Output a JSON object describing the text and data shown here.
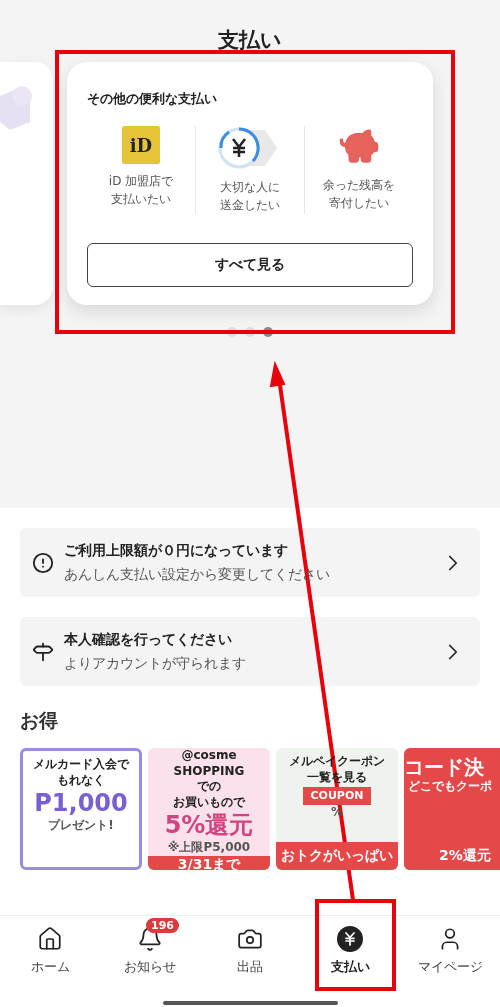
{
  "header": {
    "title": "支払い"
  },
  "carousel": {
    "card": {
      "title": "その他の便利な支払い",
      "options": [
        {
          "kind": "id",
          "icon_text": "iD",
          "lines": [
            "iD 加盟店で",
            "支払いたい"
          ]
        },
        {
          "kind": "transfer",
          "lines": [
            "大切な人に",
            "送金したい"
          ]
        },
        {
          "kind": "donate",
          "lines": [
            "余った残高を",
            "寄付したい"
          ]
        }
      ],
      "button": "すべて見る"
    },
    "pages": [
      {
        "selected": false
      },
      {
        "selected": false
      },
      {
        "selected": true
      }
    ]
  },
  "notices": [
    {
      "kind": "warning",
      "title": "ご利用上限額が０円になっています",
      "subtitle": "あんしん支払い設定から変更してください"
    },
    {
      "kind": "identity",
      "title": "本人確認を行ってください",
      "subtitle": "よりアカウントが守られます"
    }
  ],
  "deals": {
    "title": "お得",
    "banners": [
      {
        "kind": "card",
        "lines": [
          "メルカード入会で",
          "もれなく"
        ],
        "big": "P1,000",
        "note": "プレゼント!"
      },
      {
        "kind": "cosme",
        "lines": [
          "@cosme",
          "SHOPPING",
          "での",
          "お買いもので"
        ],
        "big": "5%還元",
        "note": "※上限P5,000",
        "footer": "3/31まで"
      },
      {
        "kind": "coupon",
        "lines": [
          "メルペイクーポン",
          "一覧を見る"
        ],
        "big": "COUPON",
        "note": "%",
        "footer": "おトクがいっぱい"
      },
      {
        "kind": "code",
        "big": "コード決",
        "note": "どこでもクーポ",
        "footer": "2%還元"
      }
    ]
  },
  "tab_bar": {
    "items": [
      {
        "kind": "home",
        "label": "ホーム",
        "selected": false
      },
      {
        "kind": "bell",
        "label": "お知らせ",
        "badge": "196",
        "selected": false
      },
      {
        "kind": "camera",
        "label": "出品",
        "selected": false
      },
      {
        "kind": "pay",
        "label": "支払い",
        "selected": true
      },
      {
        "kind": "user",
        "label": "マイページ",
        "selected": false
      }
    ]
  },
  "annotations": [
    {
      "kind": "frame"
    },
    {
      "kind": "frame"
    },
    {
      "kind": "arrow"
    }
  ]
}
